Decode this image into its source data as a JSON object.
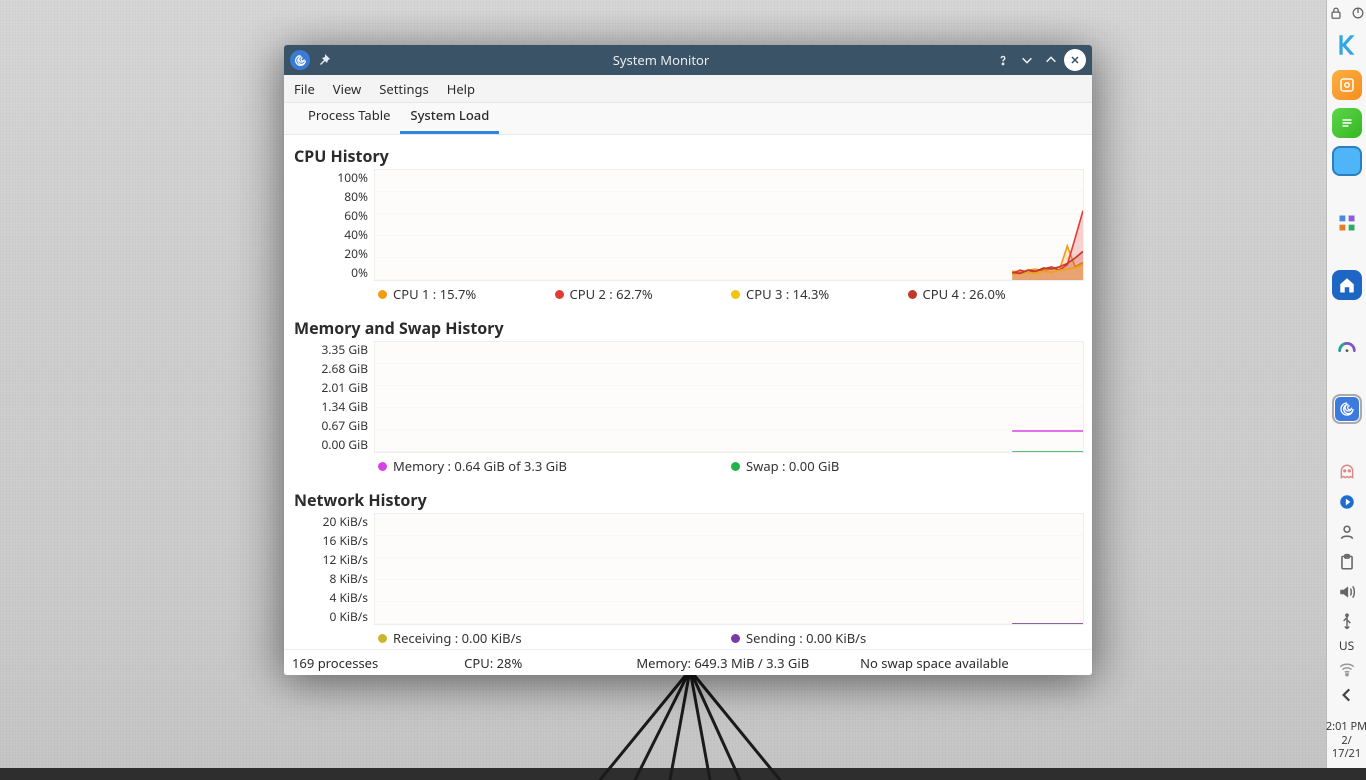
{
  "window": {
    "title": "System Monitor",
    "menubar": [
      "File",
      "View",
      "Settings",
      "Help"
    ],
    "tabs": [
      {
        "label": "Process Table",
        "active": false
      },
      {
        "label": "System Load",
        "active": true
      }
    ]
  },
  "status": {
    "processes": "169 processes",
    "cpu": "CPU: 28%",
    "memory": "Memory: 649.3 MiB / 3.3 GiB",
    "swap": "No swap space available"
  },
  "panel": {
    "locale": "US",
    "time": "2:01 PM",
    "date1": "2/",
    "date2": "17/21"
  },
  "chart_data": [
    {
      "type": "line",
      "title": "CPU History",
      "ylim": [
        0,
        100
      ],
      "yticks": [
        "100%",
        "80%",
        "60%",
        "40%",
        "20%",
        "0%"
      ],
      "ylabel": "",
      "xlabel": "",
      "series": [
        {
          "name": "CPU 1 : 15.7%",
          "color": "#f39c12",
          "values": [
            8,
            7,
            9,
            10,
            8,
            11,
            9,
            31,
            12,
            16
          ]
        },
        {
          "name": "CPU 2 : 62.7%",
          "color": "#e53935",
          "values": [
            6,
            9,
            7,
            8,
            10,
            12,
            9,
            14,
            38,
            63
          ]
        },
        {
          "name": "CPU 3 : 14.3%",
          "color": "#f1c40f",
          "values": [
            5,
            6,
            7,
            6,
            8,
            7,
            9,
            10,
            11,
            14
          ]
        },
        {
          "name": "CPU 4 : 26.0%",
          "color": "#c0392b",
          "values": [
            7,
            6,
            9,
            8,
            11,
            10,
            12,
            15,
            20,
            26
          ]
        }
      ]
    },
    {
      "type": "line",
      "title": "Memory and Swap History",
      "ylim": [
        0,
        3.35
      ],
      "yticks": [
        "3.35 GiB",
        "2.68 GiB",
        "2.01 GiB",
        "1.34 GiB",
        "0.67 GiB",
        "0.00 GiB"
      ],
      "ylabel": "",
      "xlabel": "",
      "series": [
        {
          "name": "Memory : 0.64 GiB of 3.3 GiB",
          "color": "#d843e6",
          "values": [
            0.64,
            0.64,
            0.64,
            0.64,
            0.64,
            0.64,
            0.64,
            0.64,
            0.64,
            0.64
          ]
        },
        {
          "name": "Swap : 0.00 GiB",
          "color": "#21b24b",
          "values": [
            0,
            0,
            0,
            0,
            0,
            0,
            0,
            0,
            0,
            0
          ]
        }
      ]
    },
    {
      "type": "line",
      "title": "Network History",
      "ylim": [
        0,
        20
      ],
      "yticks": [
        "20 KiB/s",
        "16 KiB/s",
        "12 KiB/s",
        "8 KiB/s",
        "4 KiB/s",
        "0 KiB/s"
      ],
      "ylabel": "",
      "xlabel": "",
      "series": [
        {
          "name": "Receiving : 0.00 KiB/s",
          "color": "#cbb52b",
          "values": [
            0,
            0,
            0,
            0,
            0,
            0,
            0,
            0,
            0,
            0
          ]
        },
        {
          "name": "Sending : 0.00 KiB/s",
          "color": "#7c3aa8",
          "values": [
            0,
            0,
            0,
            0,
            0,
            0,
            0,
            0,
            0,
            0
          ]
        }
      ]
    }
  ]
}
